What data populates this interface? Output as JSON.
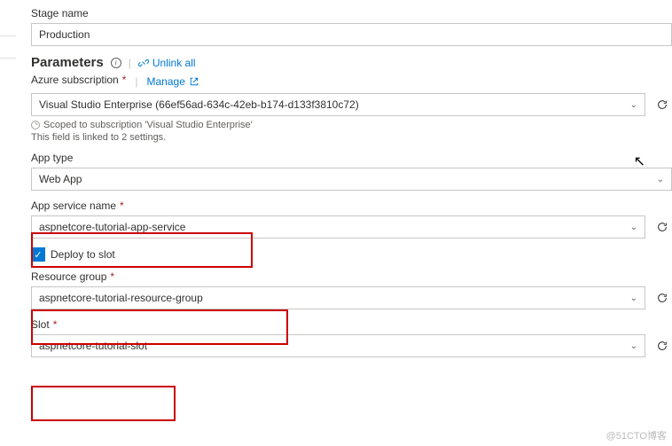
{
  "stage": {
    "label": "Stage name",
    "value": "Production"
  },
  "parameters": {
    "title": "Parameters",
    "unlink_label": "Unlink all"
  },
  "subscription": {
    "label": "Azure subscription",
    "manage_label": "Manage",
    "value": "Visual Studio Enterprise (66ef56ad-634c-42eb-b174-d133f3810c72)",
    "scoped_hint": "Scoped to subscription 'Visual Studio Enterprise'",
    "linked_hint": "This field is linked to 2 settings."
  },
  "app_type": {
    "label": "App type",
    "value": "Web App"
  },
  "app_service": {
    "label": "App service name",
    "value": "aspnetcore-tutorial-app-service"
  },
  "deploy_slot": {
    "label": "Deploy to slot",
    "checked": true
  },
  "resource_group": {
    "label": "Resource group",
    "value": "aspnetcore-tutorial-resource-group"
  },
  "slot": {
    "label": "Slot",
    "value": "aspnetcore-tutorial-slot"
  },
  "watermark": "@51CTO博客"
}
